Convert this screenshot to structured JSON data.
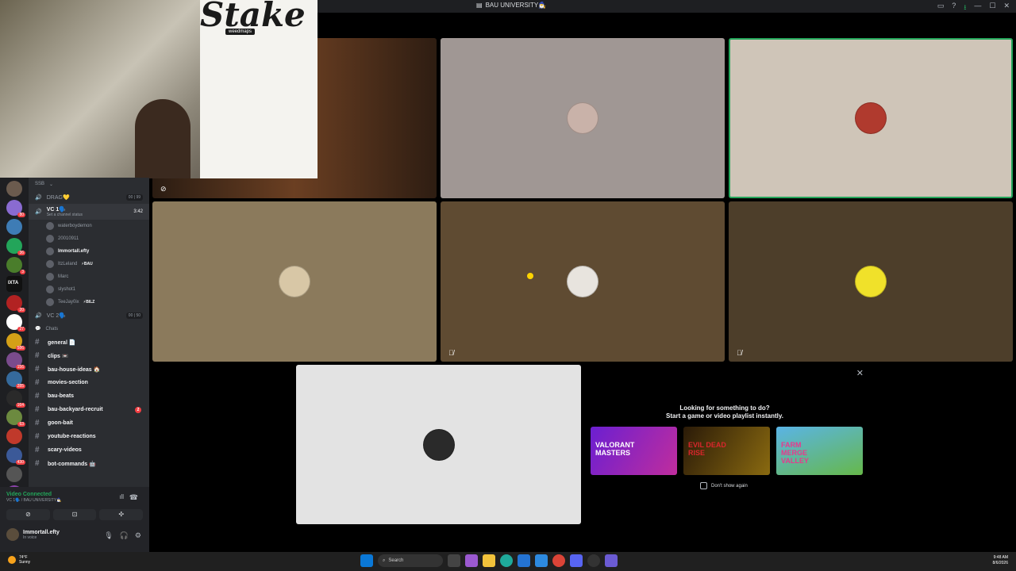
{
  "window": {
    "title": "BAU UNIVERSITY🧙‍♂️"
  },
  "colors": {
    "accent": "#5865f2",
    "voice_connected": "#23a55a",
    "sidebar": "#2b2d31",
    "speaking_outline": "#23a55a"
  },
  "channels": {
    "category": "SSB",
    "voice": [
      {
        "name": "DRAG💛",
        "count_a": "00",
        "count_b": "99"
      },
      {
        "name": "VC 1🗣️",
        "timer": "3:42",
        "status": "Set a channel status"
      }
    ],
    "members": [
      {
        "name": "waterboydemon",
        "tag": ""
      },
      {
        "name": "20010911",
        "tag": ""
      },
      {
        "name": "Immortall.efty",
        "tag": ""
      },
      {
        "name": "ItzLeland",
        "tag": "⚡BAU"
      },
      {
        "name": "Marc",
        "tag": ""
      },
      {
        "name": "slyshot1",
        "tag": ""
      },
      {
        "name": "TeeJay0ix",
        "tag": "⚡BILZ"
      }
    ],
    "voice2": {
      "name": "VC 2🗣️",
      "count_a": "00",
      "count_b": "50"
    },
    "chats_category": "Chats",
    "text": [
      {
        "name": "general 📄",
        "badge": ""
      },
      {
        "name": "clips 📼",
        "badge": ""
      },
      {
        "name": "bau-house-ideas 🏠",
        "badge": ""
      },
      {
        "name": "movies-section",
        "badge": ""
      },
      {
        "name": "bau-beats",
        "badge": ""
      },
      {
        "name": "bau-backyard-recruit",
        "badge": "2"
      },
      {
        "name": "goon-bait",
        "badge": ""
      },
      {
        "name": "youtube-reactions",
        "badge": ""
      },
      {
        "name": "scary-videos",
        "badge": ""
      },
      {
        "name": "bot-commands 🤖",
        "badge": ""
      }
    ]
  },
  "servers": [
    {
      "color": "#6b5b4e",
      "badge": ""
    },
    {
      "color": "#8a6bd1",
      "badge": "80"
    },
    {
      "color": "#3e7cb5",
      "badge": ""
    },
    {
      "color": "#23a55a",
      "badge": "36"
    },
    {
      "color": "#4a7d2b",
      "badge": "3"
    },
    {
      "color": "#111111",
      "badge": "",
      "label": "IXTA"
    },
    {
      "color": "#b22222",
      "badge": "20"
    },
    {
      "color": "#ffffff",
      "badge": "27"
    },
    {
      "color": "#d4a017",
      "badge": "586"
    },
    {
      "color": "#7a4b8c",
      "badge": "156"
    },
    {
      "color": "#356a9c",
      "badge": "285"
    },
    {
      "color": "#2a2a2a",
      "badge": "164"
    },
    {
      "color": "#6c8a3f",
      "badge": "63"
    },
    {
      "color": "#c0392b",
      "badge": ""
    },
    {
      "color": "#3b5998",
      "badge": "430"
    },
    {
      "color": "#555555",
      "badge": ""
    },
    {
      "color": "#8e44ad",
      "badge": ""
    }
  ],
  "servers_new_label": "NEW",
  "voice_panel": {
    "status": "Video Connected",
    "location": "VC 1🗣️ / BAU UNIVERSITY🧙‍♂️"
  },
  "user": {
    "name": "Immortall.efty",
    "status": "In voice"
  },
  "webcam": {
    "logo_text": "Stake",
    "sponsor": "weedmaps"
  },
  "activity": {
    "line1": "Looking for something to do?",
    "line2": "Start a game or video playlist instantly.",
    "cards": [
      {
        "title": "VALORANT MASTERS",
        "color_a": "#6b1fd1",
        "color_b": "#c02d9d"
      },
      {
        "title": "EVIL DEAD RISE",
        "color_a": "#2a1a08",
        "color_b": "#8a6a10"
      },
      {
        "title": "FARM MERGE VALLEY",
        "color_a": "#5ab4e6",
        "color_b": "#66b84a"
      }
    ],
    "dont_show": "Don't show again"
  },
  "taskbar": {
    "weather_temp": "74°F",
    "weather_desc": "Sunny",
    "search_placeholder": "Search",
    "time": "9:48 AM",
    "date": "8/6/2026"
  }
}
